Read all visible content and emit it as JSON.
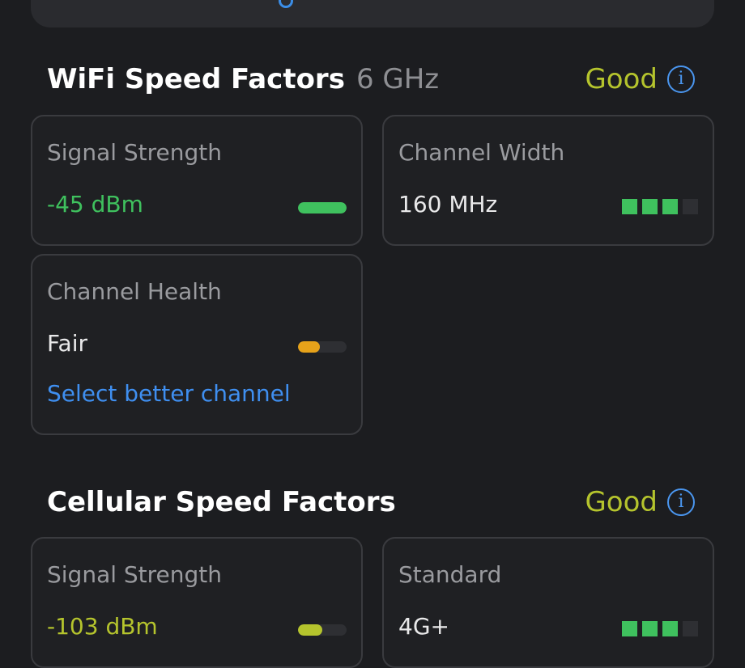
{
  "wifi": {
    "title": "WiFi Speed Factors",
    "band": "6 GHz",
    "status": "Good",
    "cards": {
      "signal": {
        "label": "Signal Strength",
        "value": "-45 dBm",
        "level": 1.0,
        "color": "#3fc15e"
      },
      "width": {
        "label": "Channel Width",
        "value": "160 MHz",
        "blocks_on": 3,
        "blocks_total": 4
      },
      "health": {
        "label": "Channel Health",
        "value": "Fair",
        "level": 0.45,
        "color": "#e6a21a",
        "link": "Select better channel"
      }
    }
  },
  "cellular": {
    "title": "Cellular Speed Factors",
    "status": "Good",
    "cards": {
      "signal": {
        "label": "Signal Strength",
        "value": "-103 dBm",
        "level": 0.5,
        "color": "#b5c42d"
      },
      "standard": {
        "label": "Standard",
        "value": "4G+",
        "blocks_on": 3,
        "blocks_total": 4
      }
    }
  },
  "colors": {
    "status_good": "#b5c42d",
    "accent": "#3f8ff0",
    "background": "#1c1d20"
  }
}
